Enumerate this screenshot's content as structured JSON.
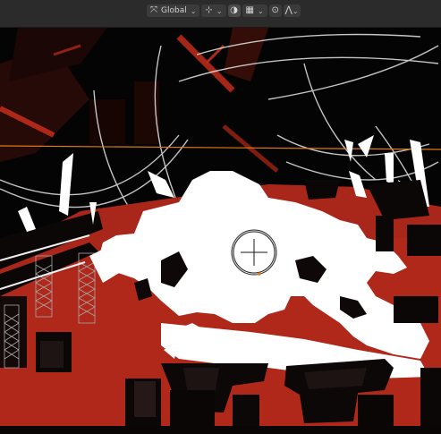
{
  "header": {
    "transform_pivot_icon": "pivot-icon",
    "orientation_value": "Global",
    "snap_icon": "magnet-icon",
    "snap_increment_icon": "grid-snap-icon",
    "proportional_edit_icon": "circle-dot-icon",
    "falloff_icon": "falloff-curve-icon"
  },
  "viewport": {
    "background": "#050404",
    "floor_color": "#b0281a",
    "accent_orange": "#e07a18",
    "highlight": "#ffffff",
    "selection_outline": "#d56b14"
  }
}
